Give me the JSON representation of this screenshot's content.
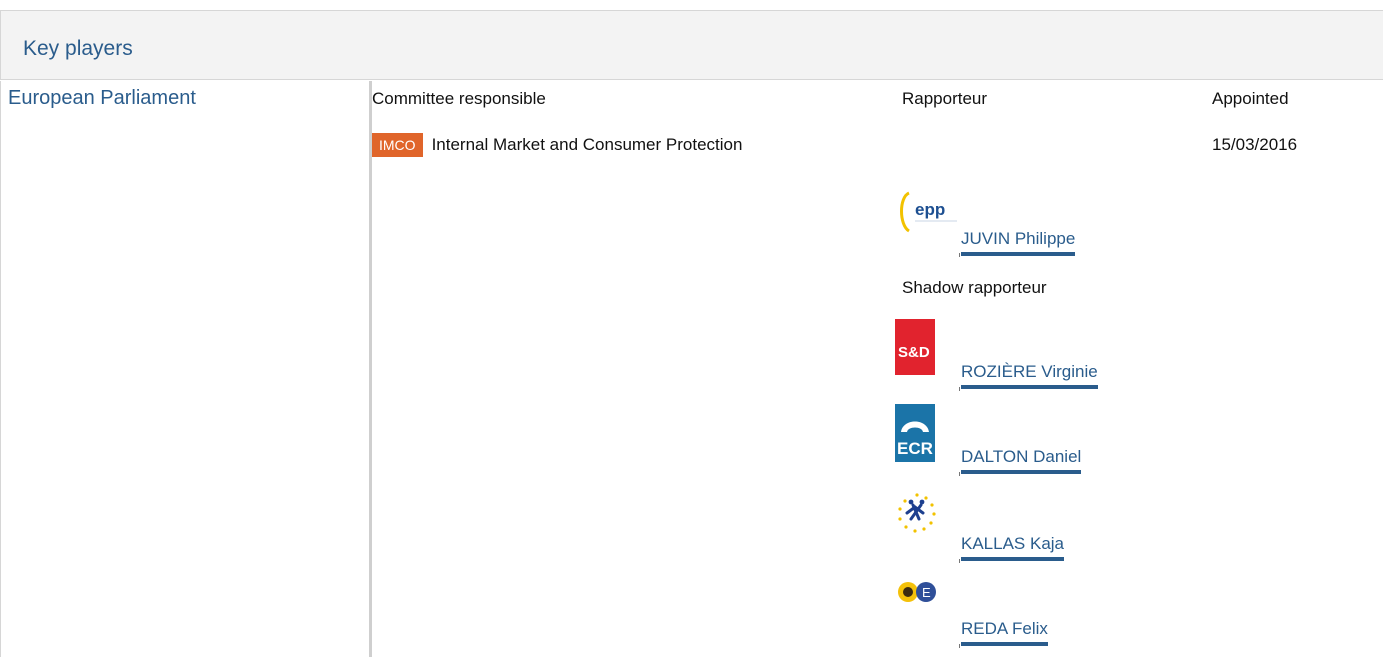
{
  "section": {
    "title": "Key players"
  },
  "institution": {
    "name": "European Parliament"
  },
  "columns": {
    "committee": "Committee responsible",
    "rapporteur": "Rapporteur",
    "appointed": "Appointed"
  },
  "committee": {
    "abbr": "IMCO",
    "name": "Internal Market and Consumer Protection",
    "appointed": "15/03/2016",
    "badge_color": "#e0652a"
  },
  "rapporteur": {
    "name": "JUVIN Philippe",
    "group_icon": "epp-logo-icon"
  },
  "shadow": {
    "label": "Shadow rapporteur",
    "members": [
      {
        "name": "ROZIÈRE Virginie",
        "group_icon": "sd-logo-icon",
        "logo_text": "S&D"
      },
      {
        "name": "DALTON Daniel",
        "group_icon": "ecr-logo-icon",
        "logo_text": "ECR"
      },
      {
        "name": "KALLAS Kaja",
        "group_icon": "alde-logo-icon"
      },
      {
        "name": "REDA Felix",
        "group_icon": "greens-efa-logo-icon"
      }
    ]
  },
  "colors": {
    "link": "#2a5c8c",
    "header_bg": "#f3f3f3",
    "sd_red": "#e1232e",
    "ecr_blue": "#1b74a8"
  }
}
